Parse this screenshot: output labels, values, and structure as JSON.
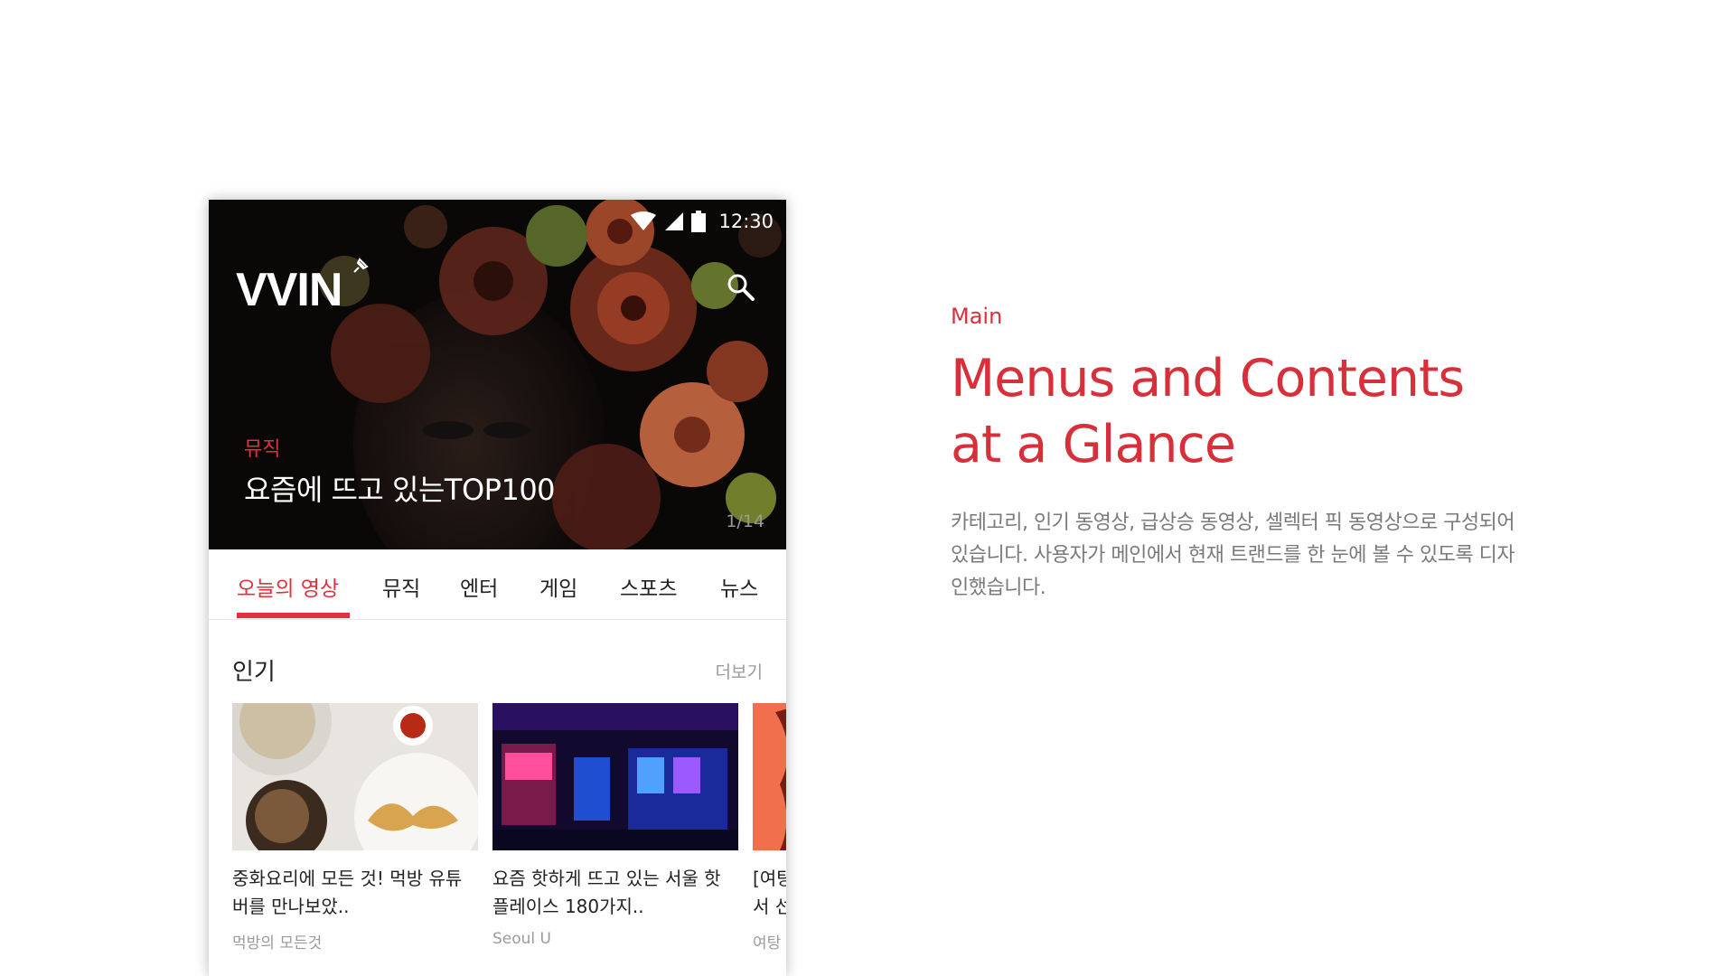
{
  "phone": {
    "status_bar": {
      "time": "12:30"
    },
    "header": {
      "logo_text": "VVIN"
    },
    "hero": {
      "category": "뮤직",
      "title": "요즘에 뜨고 있는TOP100",
      "pager": "1/14"
    },
    "tabs": [
      {
        "label": "오늘의 영상",
        "active": true
      },
      {
        "label": "뮤직"
      },
      {
        "label": "엔터"
      },
      {
        "label": "게임"
      },
      {
        "label": "스포츠"
      },
      {
        "label": "뉴스"
      }
    ],
    "section": {
      "title": "인기",
      "more_label": "더보기",
      "cards": [
        {
          "title": "중화요리에 모든 것! 먹방 유튜\n버를 만나보았..",
          "channel": "먹방의 모든것"
        },
        {
          "title": "요즘 핫하게 뜨고 있는 서울 핫\n플레이스 180가지..",
          "channel": "Seoul U"
        },
        {
          "title": "[여탕\n서 선",
          "channel": "여탕"
        }
      ]
    },
    "icons": [
      "wifi-icon",
      "signal-icon",
      "battery-icon",
      "search-icon",
      "pin-icon"
    ]
  },
  "info": {
    "eyebrow": "Main",
    "headline": "Menus and Contents\nat a Glance",
    "description": "카테고리, 인기 동영상, 급상승 동영상, 셀렉터 픽 동영상으로 구성되어있습니다. 사용자가 메인에서 현재 트랜드를 한 눈에 볼 수 있도록 디자인했습니다."
  },
  "colors": {
    "accent": "#d8303b",
    "hero_bg": "#0a0707",
    "text": "#222222",
    "muted": "#9b9b9b"
  }
}
